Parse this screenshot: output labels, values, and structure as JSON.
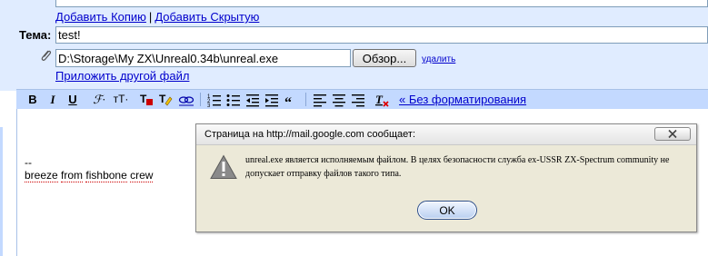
{
  "recipients": {
    "add_cc": "Добавить Копию",
    "separator": "|",
    "add_bcc": "Добавить Скрытую"
  },
  "subject": {
    "label": "Тема:",
    "value": "test!"
  },
  "attachment": {
    "path": "D:\\Storage\\My ZX\\Unreal0.34b\\unreal.exe",
    "browse_label": "Обзор...",
    "remove_label": "удалить",
    "attach_another": "Приложить другой файл"
  },
  "toolbar": {
    "bold": "B",
    "italic": "I",
    "underline": "U",
    "font": "ℱ·",
    "size": "тT·",
    "no_format": "« Без форматирования",
    "colors": {
      "background": "#c3d9ff",
      "link": "#0000cc"
    }
  },
  "editor": {
    "sig_dashes": "--",
    "sig_words": [
      "breeze",
      "from",
      "fishbone",
      "crew"
    ]
  },
  "dialog": {
    "title": "Страница на http://mail.google.com сообщает:",
    "message": "unreal.exe является исполняемым файлом. В целях безопасности служба ex-USSR ZX-Spectrum community не допускает отправку файлов такого типа.",
    "ok_label": "OK",
    "icon": "warning-icon"
  }
}
